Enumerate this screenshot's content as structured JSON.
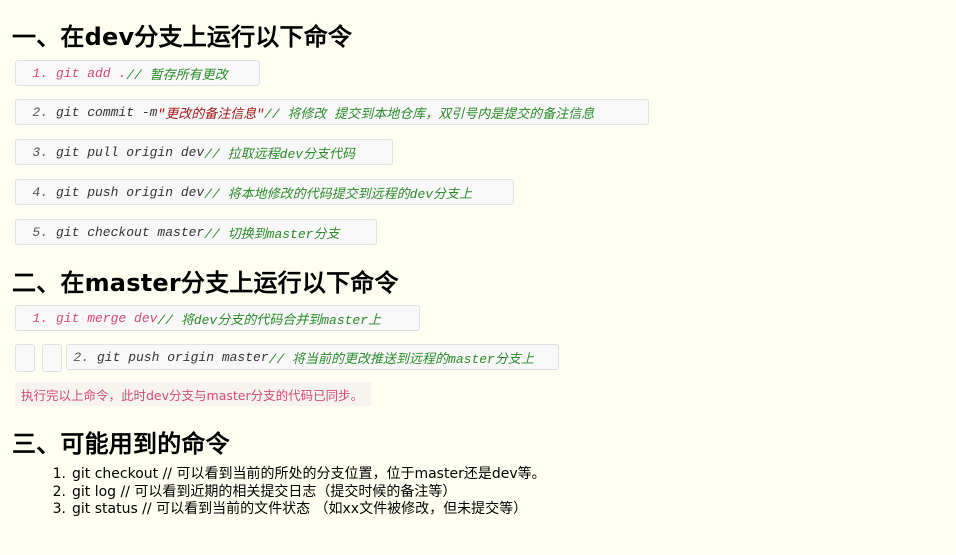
{
  "sections": {
    "s1_title": "一、在dev分支上运行以下命令",
    "s2_title": "二、在master分支上运行以下命令",
    "s3_title": "三、可能用到的命令"
  },
  "dev_commands": [
    {
      "num": "1.",
      "cmd": "git add . ",
      "comment": "// 暂存所有更改"
    },
    {
      "num": "2.",
      "cmd": "git commit -m ",
      "str": "\"更改的备注信息\"",
      "comment": " // 将修改 提交到本地仓库，双引号内是提交的备注信息"
    },
    {
      "num": "3.",
      "cmd": "git pull origin dev ",
      "comment": "// 拉取远程dev分支代码"
    },
    {
      "num": "4.",
      "cmd": "git push origin dev ",
      "comment": "// 将本地修改的代码提交到远程的dev分支上"
    },
    {
      "num": "5.",
      "cmd": "git checkout master ",
      "comment": "// 切换到master分支"
    }
  ],
  "master_commands": [
    {
      "num": "1.",
      "cmd": "git merge dev ",
      "comment": "// 将dev分支的代码合并到master上"
    },
    {
      "num": "2.",
      "cmd": "git push origin master ",
      "comment": "// 将当前的更改推送到远程的master分支上"
    }
  ],
  "note": "执行完以上命令，此时dev分支与master分支的代码已同步。",
  "other_commands": [
    {
      "num": "1.",
      "text": "git checkout  // 可以看到当前的所处的分支位置，位于master还是dev等。"
    },
    {
      "num": "2.",
      "text": "git log  // 可以看到近期的相关提交日志（提交时候的备注等）"
    },
    {
      "num": "3.",
      "text": "git status  // 可以看到当前的文件状态 （如xx文件被修改，但未提交等）"
    }
  ]
}
